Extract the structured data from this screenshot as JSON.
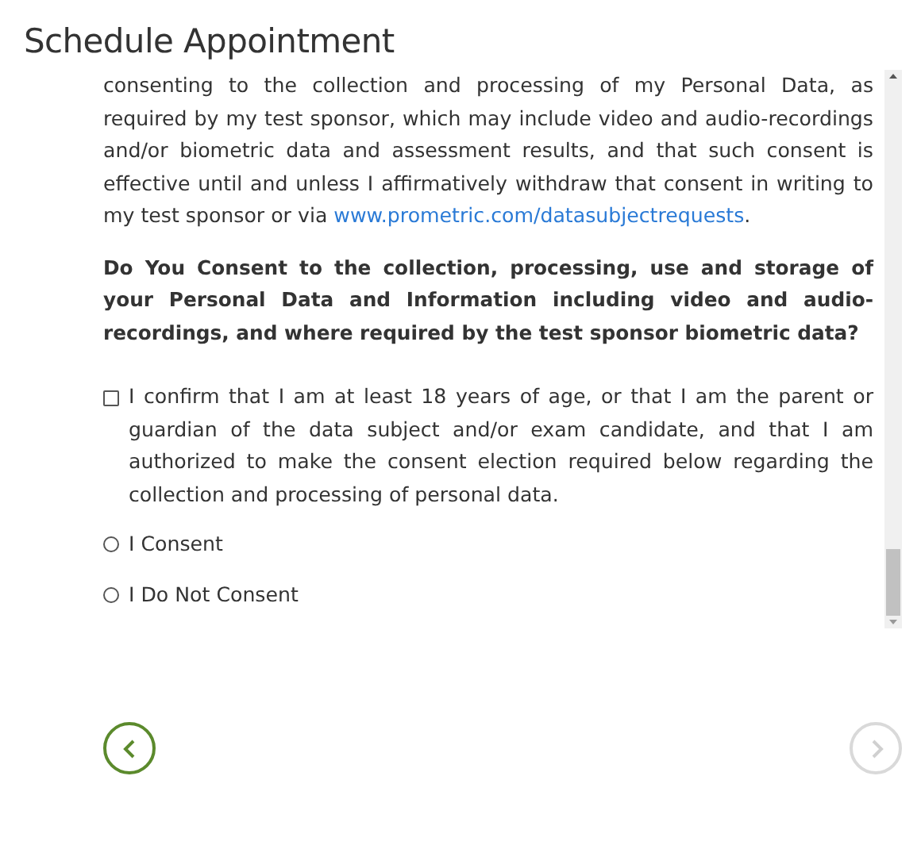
{
  "title": "Schedule Appointment",
  "paragraph": {
    "before": "consenting to the collection and processing of my Personal Data, as required by my test sponsor, which may include video and audio-recordings and/or biometric data and assessment results, and that such consent is effective until and unless I affirmatively withdraw that consent in writing to my test sponsor or via ",
    "link": "www.prometric.com/datasubjectrequests",
    "after": "."
  },
  "question": "Do You Consent to the collection, processing, use and storage of your Personal Data and Information including video and audio-recordings, and where required by the test sponsor biometric data?",
  "confirmation": {
    "label": "I confirm that I am at least 18 years of age, or that I am the parent or guardian of the data subject and/or exam candidate, and that I am authorized to make the consent election required below regarding the collection and processing of personal data.",
    "checked": false
  },
  "options": [
    {
      "label": "I Consent",
      "selected": false
    },
    {
      "label": "I Do Not Consent",
      "selected": false
    }
  ],
  "navigation": {
    "back": {
      "disabled": false
    },
    "next": {
      "disabled": true
    }
  }
}
